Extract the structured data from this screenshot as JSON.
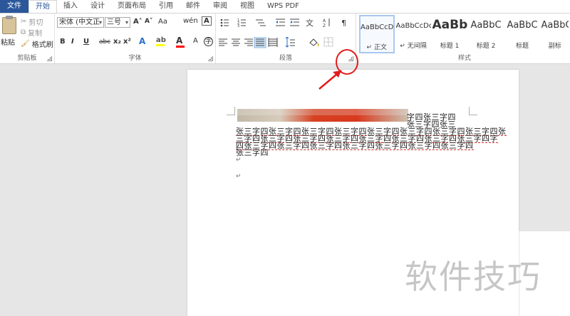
{
  "tabs": [
    "文件",
    "开始",
    "插入",
    "设计",
    "页面布局",
    "引用",
    "邮件",
    "审阅",
    "视图",
    "WPS PDF"
  ],
  "active_tab": "开始",
  "clipboard": {
    "paste_label": "粘贴",
    "cut_label": "剪切",
    "copy_label": "复制",
    "format_painter_label": "格式刷",
    "group_label": "剪贴板"
  },
  "font": {
    "font_name": "宋体 (中文正",
    "font_size": "三号",
    "grow_label": "A˄",
    "shrink_label": "A˅",
    "case_label": "Aa",
    "bold": "B",
    "italic": "I",
    "underline": "U",
    "strike": "abc",
    "subscript": "x₂",
    "superscript": "x²",
    "group_label": "字体",
    "colors": {
      "highlight": "#ffff00",
      "font_color": "#ff0000"
    }
  },
  "paragraph": {
    "group_label": "段落"
  },
  "styles": {
    "group_label": "样式",
    "items": [
      {
        "sample": "AaBbCcDd",
        "name": "↵ 正文"
      },
      {
        "sample": "AaBbCcDd",
        "name": "↵ 无间隔"
      },
      {
        "sample": "AaBb",
        "name": "标题 1"
      },
      {
        "sample": "AaBbC",
        "name": "标题 2"
      },
      {
        "sample": "AaBbC",
        "name": "标题"
      },
      {
        "sample": "AaBbC",
        "name": "副标"
      }
    ]
  },
  "document": {
    "lines": [
      "字四张三字四",
      "张三字四张三",
      "张三字四张三字四张三字四张三字四张三字四张三字四张三字四张三字四张",
      "三字四张三字四张三字四张三字四张三字四张三字四张三字四张三字四字",
      "四张三字四张三字四张三字四张三字四张三字四张三字四张三字四",
      "张三字四"
    ],
    "para_mark": "↵"
  },
  "watermark": "软件技巧"
}
